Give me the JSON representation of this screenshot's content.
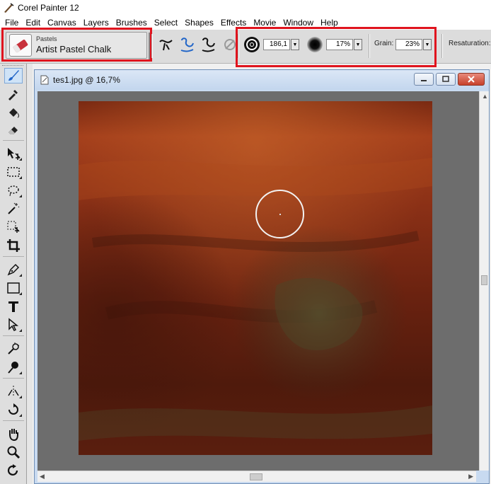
{
  "app": {
    "title": "Corel Painter 12"
  },
  "menu": {
    "items": [
      {
        "label": "File"
      },
      {
        "label": "Edit"
      },
      {
        "label": "Canvas"
      },
      {
        "label": "Layers"
      },
      {
        "label": "Brushes"
      },
      {
        "label": "Select"
      },
      {
        "label": "Shapes"
      },
      {
        "label": "Effects"
      },
      {
        "label": "Movie"
      },
      {
        "label": "Window"
      },
      {
        "label": "Help"
      }
    ]
  },
  "property_bar": {
    "brush_category": "Pastels",
    "brush_variant": "Artist Pastel Chalk",
    "size_value": "186,1",
    "opacity_value": "17%",
    "grain_label": "Grain:",
    "grain_value": "23%",
    "resaturation_label": "Resaturation:"
  },
  "document": {
    "title": "tes1.jpg @ 16,7%"
  },
  "colors": {
    "highlight": "#e0141e",
    "accent": "#2266c8",
    "painting_base": "#6e2410"
  }
}
